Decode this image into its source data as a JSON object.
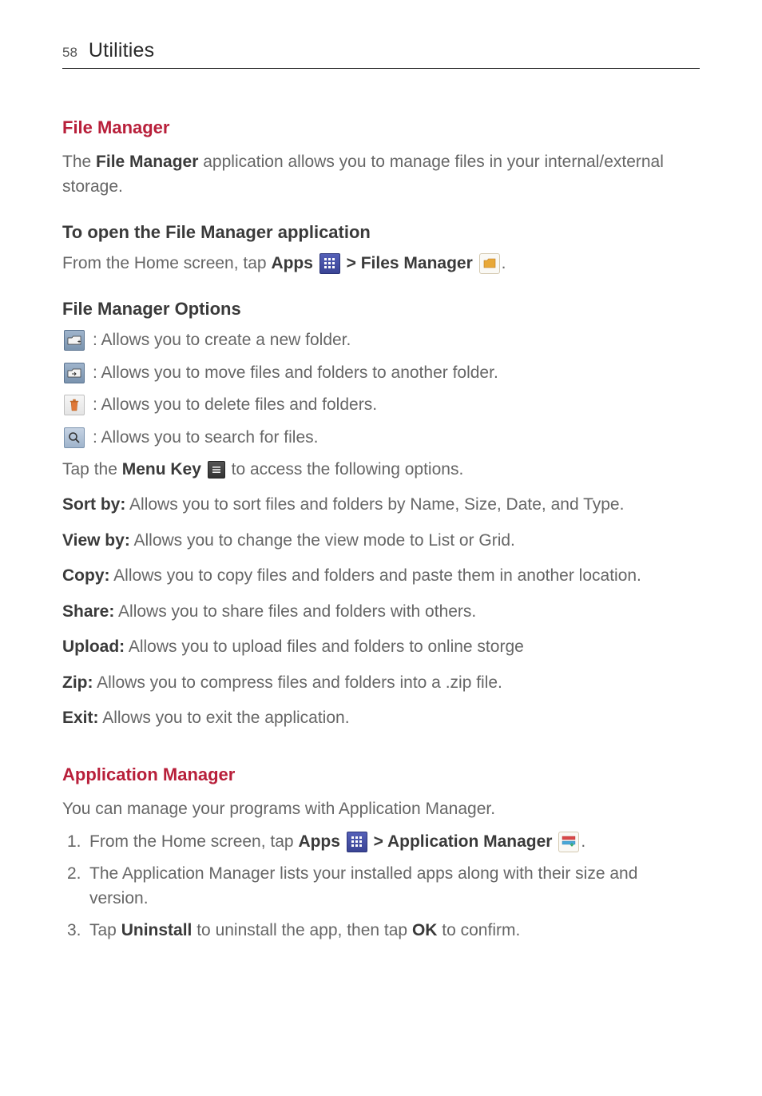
{
  "header": {
    "page_number": "58",
    "title": "Utilities"
  },
  "section1": {
    "heading": "File Manager",
    "intro_pre": "The ",
    "intro_bold": "File Manager",
    "intro_post": " application allows you to manage files in your internal/external storage.",
    "open_heading": "To open the File Manager application",
    "open_pre": "From the Home screen, tap ",
    "open_apps": "Apps",
    "open_sep": " > ",
    "open_files": "Files Manager",
    "open_end": ".",
    "options_heading": "File Manager Options",
    "opt_new_folder": " : Allows you to create a new folder.",
    "opt_move": " : Allows you to move files and folders to another folder.",
    "opt_delete": " : Allows you to delete files and folders.",
    "opt_search": " : Allows you to search for files.",
    "menu_pre": "Tap the ",
    "menu_bold": "Menu Key",
    "menu_post": " to access the following options.",
    "sort_bold": "Sort by:",
    "sort_text": " Allows you to sort files and folders by Name, Size, Date, and Type.",
    "view_bold": "View by:",
    "view_text": " Allows you to change the view mode to List or Grid.",
    "copy_bold": "Copy:",
    "copy_text": " Allows you to copy files and folders and paste them in another location.",
    "share_bold": "Share:",
    "share_text": " Allows you to share files and folders with others.",
    "upload_bold": "Upload:",
    "upload_text": " Allows you to upload files and folders  to online storge",
    "zip_bold": "Zip:",
    "zip_text": " Allows you to compress files and folders into a .zip file.",
    "exit_bold": "Exit:",
    "exit_text": " Allows you to exit the application."
  },
  "section2": {
    "heading": "Application Manager",
    "intro": "You can manage your programs with Application Manager.",
    "step1_num": "1.",
    "step1_pre": " From the Home screen, tap ",
    "step1_apps": "Apps",
    "step1_sep": " > ",
    "step1_appmgr": "Application Manager",
    "step1_end": ".",
    "step2_num": "2.",
    "step2_text": " The Application Manager lists your installed apps along with their size and version.",
    "step3_num": "3.",
    "step3_pre": " Tap ",
    "step3_uninstall": "Uninstall",
    "step3_mid": " to uninstall the app, then tap ",
    "step3_ok": "OK",
    "step3_end": " to confirm."
  }
}
